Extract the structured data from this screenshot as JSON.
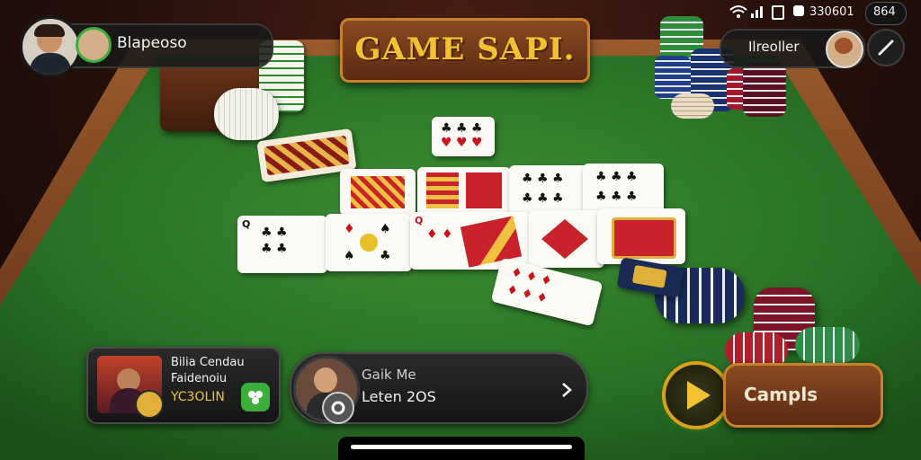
{
  "title_banner": {
    "text": "GAME SAPI."
  },
  "player_top_left": {
    "name": "Blapeoso"
  },
  "opponent_top_right": {
    "name": "Ilreoller"
  },
  "status_bar": {
    "counter": "330601",
    "battery": "864"
  },
  "bottom_left_card": {
    "line1": "Bilia Cendau",
    "line2": "Faidenoiu",
    "line3": "YC3OLIN"
  },
  "bottom_center_card": {
    "line1": "Gaik Me",
    "line2": "Leten 2OS"
  },
  "action_button": {
    "label": "Campls"
  },
  "colors": {
    "felt": "#2f7a2a",
    "wood": "#7a3f1f",
    "banner_text": "#f2c233",
    "accent_green": "#3cae3a",
    "accent_orange": "#c9802a"
  },
  "icons": [
    "wifi-icon",
    "signal-icon",
    "battery-icon",
    "edit-pencil-icon",
    "chevron-right-icon",
    "play-icon",
    "cards-icon",
    "settings-icon"
  ]
}
